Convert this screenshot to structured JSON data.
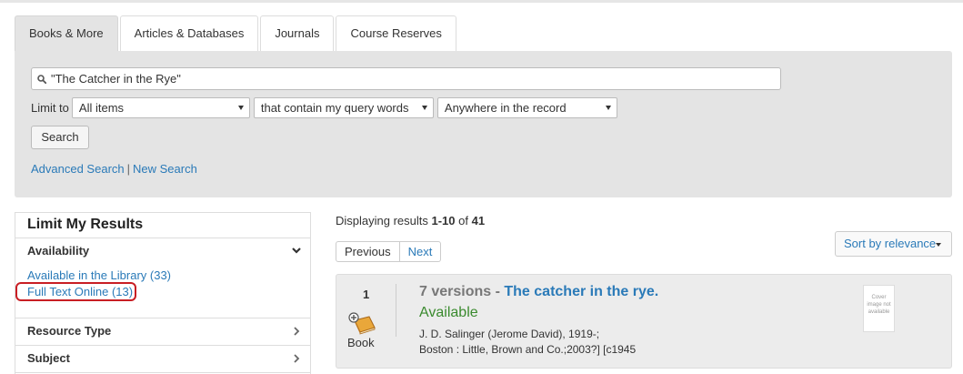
{
  "tabs": [
    {
      "label": "Books & More",
      "active": true
    },
    {
      "label": "Articles & Databases",
      "active": false
    },
    {
      "label": "Journals",
      "active": false
    },
    {
      "label": "Course Reserves",
      "active": false
    }
  ],
  "search": {
    "query": "\"The Catcher in the Rye\"",
    "limit_label": "Limit to",
    "selects": [
      "All items",
      "that contain my query words",
      "Anywhere in the record"
    ],
    "button_label": "Search",
    "advanced_link": "Advanced Search",
    "separator": "|",
    "new_link": "New Search"
  },
  "facets": {
    "title": "Limit My Results",
    "availability": {
      "label": "Availability",
      "items": [
        "Available in the Library (33)",
        "Full Text Online (13)"
      ]
    },
    "resource_type": "Resource Type",
    "subject": "Subject"
  },
  "results": {
    "display_prefix": "Displaying results ",
    "range": "1-10",
    "of_text": " of ",
    "total": "41",
    "prev_label": "Previous",
    "next_label": "Next",
    "sort_label": "Sort by relevance"
  },
  "result_item": {
    "number": "1",
    "versions": "7 versions",
    "dash": " - ",
    "title": "The catcher in the rye.",
    "status": "Available",
    "author": "J. D. Salinger (Jerome David), 1919-;",
    "publisher": "Boston : Little, Brown and Co.;2003?] [c1945",
    "format": "Book",
    "cover_text": "Cover image not available"
  },
  "colors": {
    "link": "#2a7ab8",
    "available": "#3a8a2e",
    "highlight": "#c81e24",
    "panel": "#e4e4e4"
  }
}
